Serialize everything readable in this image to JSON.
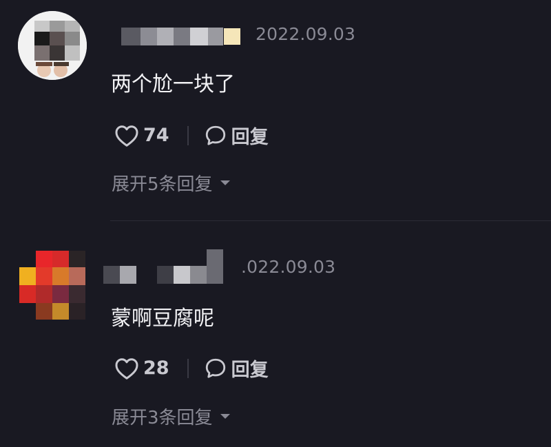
{
  "comments": [
    {
      "date": "2022.09.03",
      "text": "两个尬一块了",
      "likes": "74",
      "reply_label": "回复",
      "expand_label": "展开5条回复"
    },
    {
      "date": ".022.09.03",
      "text": "蒙啊豆腐呢",
      "likes": "28",
      "reply_label": "回复",
      "expand_label": "展开3条回复"
    }
  ],
  "icons": {
    "like": "heart-outline-icon",
    "reply": "speech-bubble-icon",
    "expand": "caret-down-icon"
  },
  "colors": {
    "background": "#191922",
    "text": "#f2f2f5",
    "muted": "#8a8a95",
    "action": "#c9c9d0",
    "badge": "#f5e6b9"
  }
}
